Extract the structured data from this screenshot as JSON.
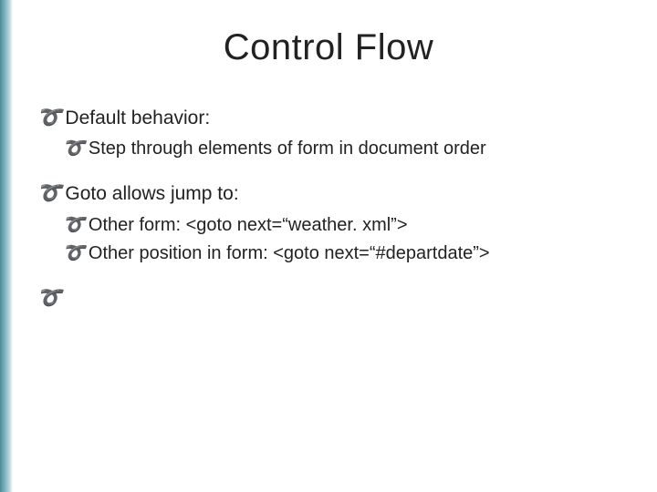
{
  "title": "Control Flow",
  "bullets": {
    "b1": "Default behavior:",
    "b1a": "Step through elements of form in document order",
    "b2": "Goto allows jump to:",
    "b2a": "Other form: <goto next=“weather. xml”>",
    "b2b": "Other position in form: <goto next=“#departdate”>",
    "b3": ""
  },
  "glyph": "༌"
}
